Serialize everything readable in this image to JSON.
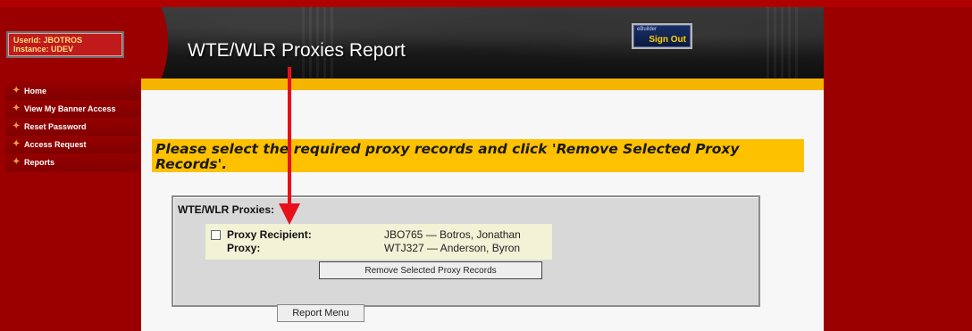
{
  "user": {
    "userid_line": "Userid: JBOTROS",
    "instance_line": "Instance: UDEV"
  },
  "nav": {
    "items": [
      {
        "label": "Home"
      },
      {
        "label": "View My Banner Access"
      },
      {
        "label": "Reset Password"
      },
      {
        "label": "Access Request"
      },
      {
        "label": "Reports"
      }
    ]
  },
  "header": {
    "title": "WTE/WLR Proxies Report",
    "signout_small": "eBuilder",
    "signout_label": "Sign Out"
  },
  "instruction": "Please select the required proxy records and click 'Remove Selected Proxy Records'.",
  "proxies": {
    "title": "WTE/WLR Proxies:",
    "records": [
      {
        "checked": false,
        "recipient_label": "Proxy Recipient:",
        "recipient_value": "JBO765 — Botros, Jonathan",
        "proxy_label": "Proxy:",
        "proxy_value": "WTJ327 — Anderson, Byron"
      }
    ],
    "remove_button": "Remove Selected Proxy Records"
  },
  "report_menu_button": "Report Menu",
  "colors": {
    "page_bg": "#9b0000",
    "gold": "#fec100",
    "arrow": "#e8101a"
  }
}
